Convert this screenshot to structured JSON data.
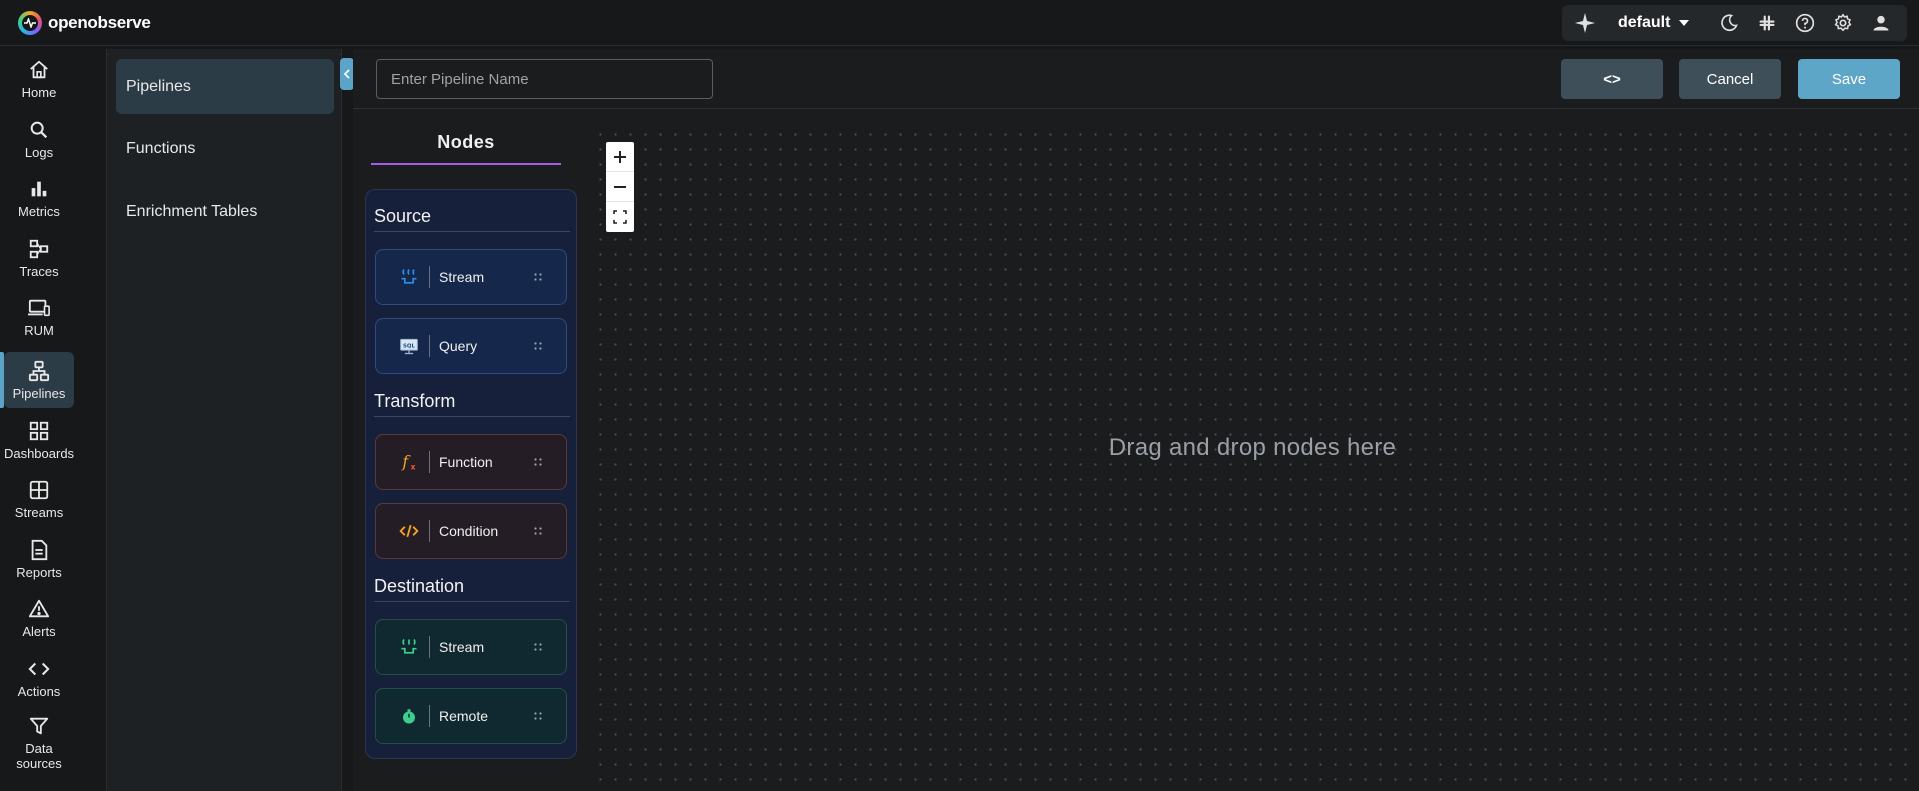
{
  "app": {
    "name": "openobserve"
  },
  "header": {
    "org": "default"
  },
  "nav": [
    {
      "label": "Home",
      "icon": "home-icon"
    },
    {
      "label": "Logs",
      "icon": "search-icon"
    },
    {
      "label": "Metrics",
      "icon": "bar-chart-icon"
    },
    {
      "label": "Traces",
      "icon": "traces-icon"
    },
    {
      "label": "RUM",
      "icon": "devices-icon"
    },
    {
      "label": "Pipelines",
      "icon": "pipelines-icon",
      "active": true
    },
    {
      "label": "Dashboards",
      "icon": "dashboard-icon"
    },
    {
      "label": "Streams",
      "icon": "streams-icon"
    },
    {
      "label": "Reports",
      "icon": "report-icon"
    },
    {
      "label": "Alerts",
      "icon": "alert-icon"
    },
    {
      "label": "Actions",
      "icon": "code-icon"
    },
    {
      "label": "Data sources",
      "icon": "filter-icon"
    }
  ],
  "submenu": [
    {
      "label": "Pipelines",
      "active": true
    },
    {
      "label": "Functions"
    },
    {
      "label": "Enrichment Tables"
    }
  ],
  "toolbar": {
    "name_placeholder": "Enter Pipeline Name",
    "name_value": "",
    "code_label": "<>",
    "cancel_label": "Cancel",
    "save_label": "Save"
  },
  "nodes": {
    "tab_label": "Nodes",
    "sections": [
      {
        "title": "Source",
        "items": [
          {
            "label": "Stream",
            "icon": "stream-input-icon"
          },
          {
            "label": "Query",
            "icon": "query-icon"
          }
        ]
      },
      {
        "title": "Transform",
        "items": [
          {
            "label": "Function",
            "icon": "function-icon"
          },
          {
            "label": "Condition",
            "icon": "condition-icon"
          }
        ]
      },
      {
        "title": "Destination",
        "items": [
          {
            "label": "Stream",
            "icon": "stream-output-icon"
          },
          {
            "label": "Remote",
            "icon": "remote-icon"
          }
        ]
      }
    ]
  },
  "canvas": {
    "drop_hint": "Drag and drop nodes here"
  },
  "colors": {
    "accent": "#5ea6c8",
    "nodes_underline": "#a45be8",
    "source_icon": "#2b8ee8",
    "transform_icon": "#f5a623",
    "destination_icon": "#3ecf8e"
  }
}
